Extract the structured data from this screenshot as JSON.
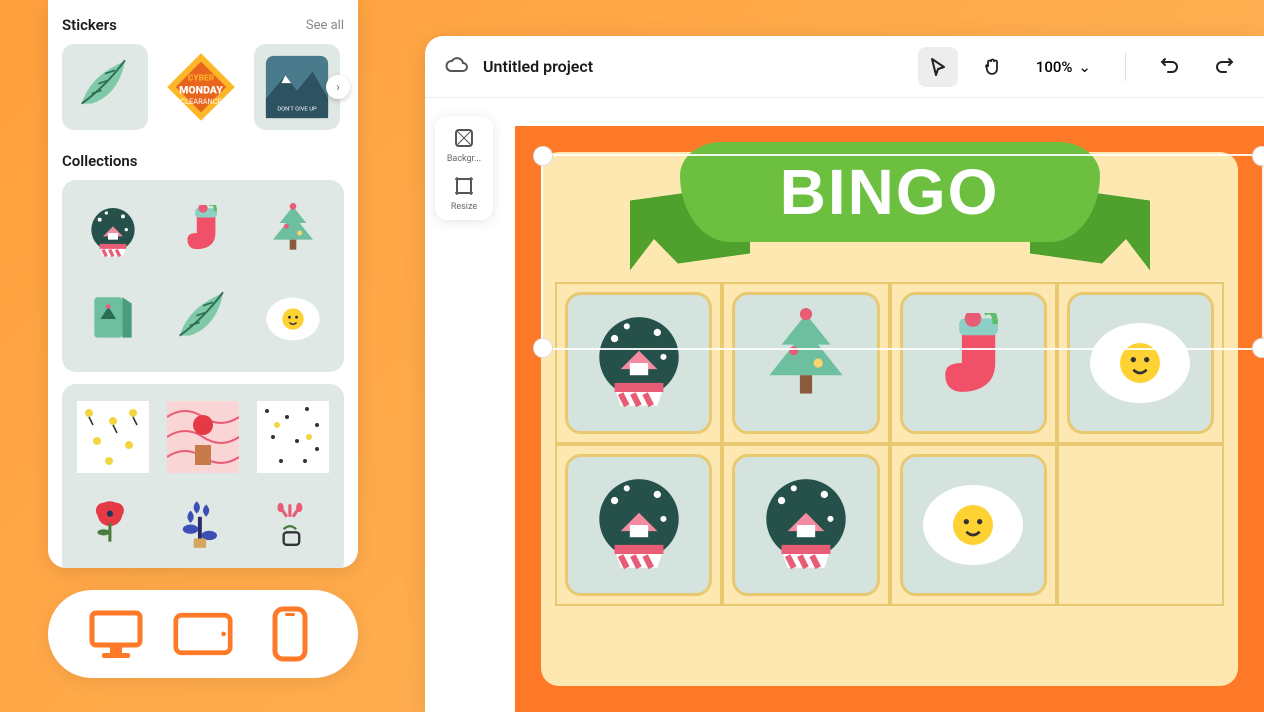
{
  "sidebar": {
    "stickers": {
      "title": "Stickers",
      "see_all": "See all"
    },
    "collections": {
      "title": "Collections"
    }
  },
  "devices": {
    "desktop": "desktop",
    "tablet": "tablet",
    "phone": "phone"
  },
  "editor": {
    "project_title": "Untitled project",
    "zoom": "100%",
    "tools": {
      "background": "Backgr...",
      "resize": "Resize"
    },
    "bingo_title": "BINGO"
  }
}
